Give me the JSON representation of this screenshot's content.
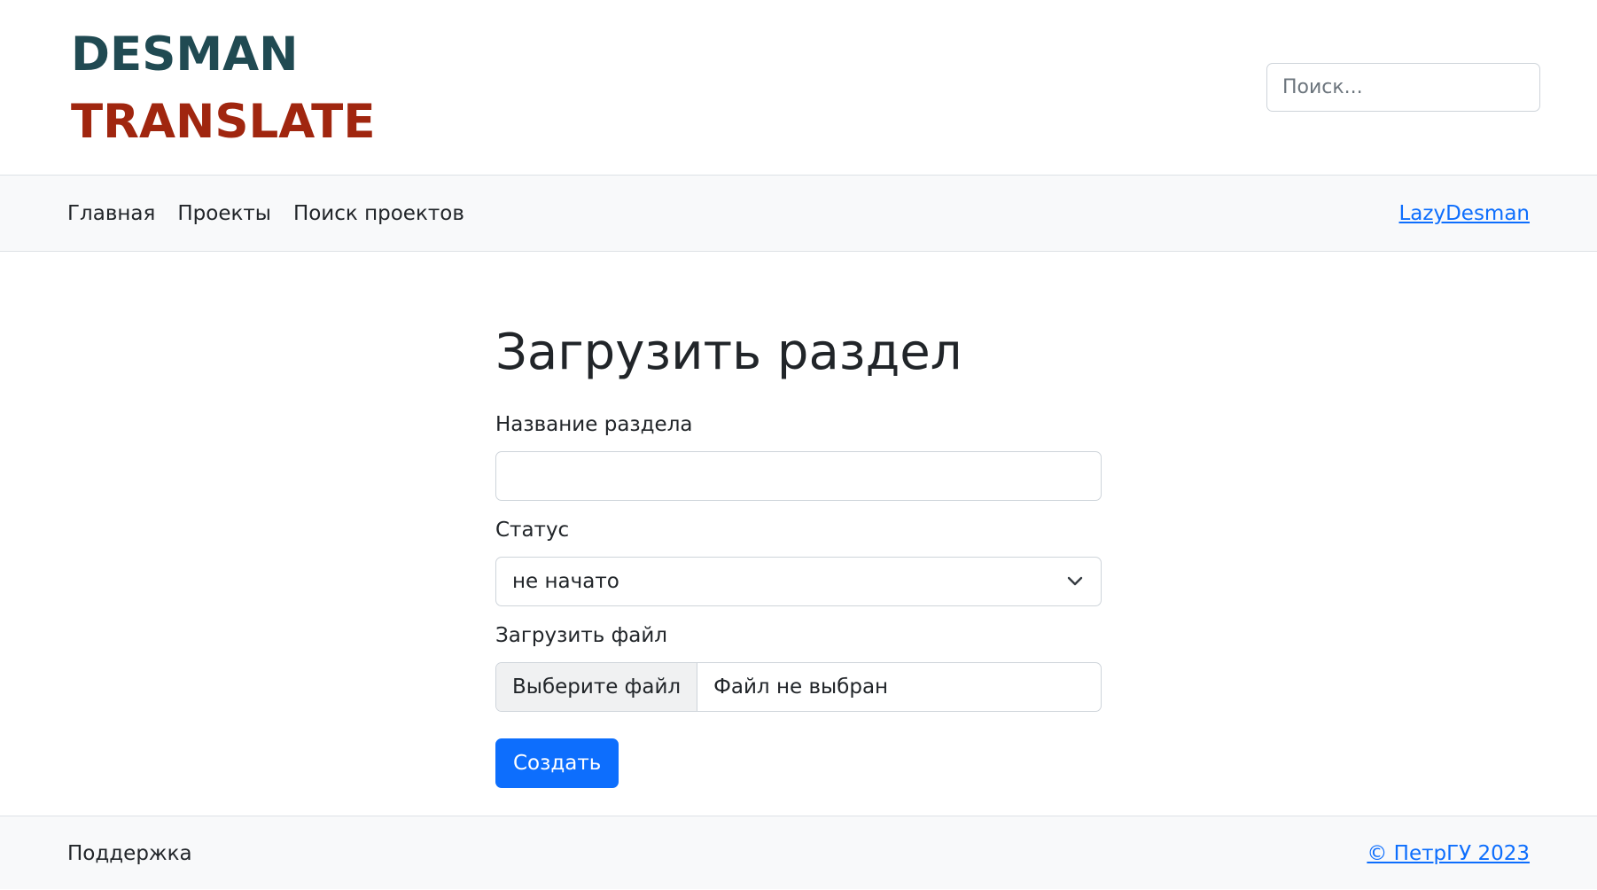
{
  "header": {
    "logo_line1": "DESMAN",
    "logo_line2": "TRANSLATE",
    "search_placeholder": "Поиск..."
  },
  "nav": {
    "links": [
      "Главная",
      "Проекты",
      "Поиск проектов"
    ],
    "user": "LazyDesman"
  },
  "form": {
    "title": "Загрузить раздел",
    "name_label": "Название раздела",
    "name_value": "",
    "status_label": "Статус",
    "status_value": "не начато",
    "file_label": "Загрузить файл",
    "file_button": "Выберите файл",
    "file_status": "Файл не выбран",
    "submit_label": "Создать"
  },
  "footer": {
    "support": "Поддержка",
    "copyright": "© ПетрГУ 2023"
  },
  "colors": {
    "logo_primary": "#204a52",
    "logo_secondary": "#a0260f",
    "accent": "#0d6efd",
    "bar_background": "#f8f9fa"
  }
}
